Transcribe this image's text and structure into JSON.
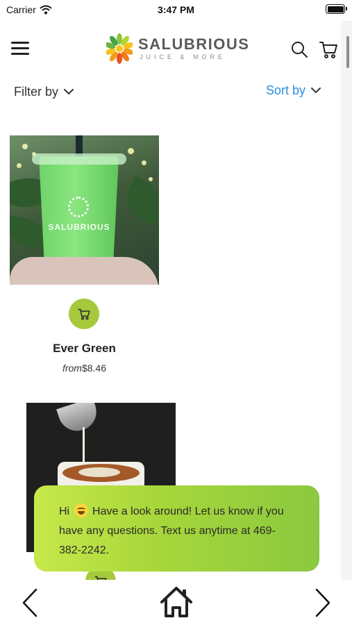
{
  "status_bar": {
    "carrier": "Carrier",
    "time": "3:47 PM",
    "icons": [
      "wifi-icon",
      "battery-icon"
    ]
  },
  "header": {
    "brand_name": "SALUBRIOUS",
    "brand_tagline": "JUICE & MORE",
    "icons": [
      "menu-icon",
      "search-icon",
      "cart-icon"
    ]
  },
  "toolbar": {
    "filter_label": "Filter by",
    "sort_label": "Sort by",
    "sort_color": "#2a8ee0"
  },
  "products": [
    {
      "name": "Ever Green",
      "price_prefix": "from",
      "price": "$8.46"
    },
    {
      "name": "",
      "price_prefix": "",
      "price": ""
    }
  ],
  "chat": {
    "message": "Hi 😄 Have a look around! Let us know if you have any questions. Text us anytime at 469-382-2242.",
    "color": "#a6d63a"
  },
  "bottom_nav": {
    "icons": [
      "back-arrow-icon",
      "home-icon",
      "forward-arrow-icon"
    ]
  },
  "accent_color": "#a5c93b"
}
